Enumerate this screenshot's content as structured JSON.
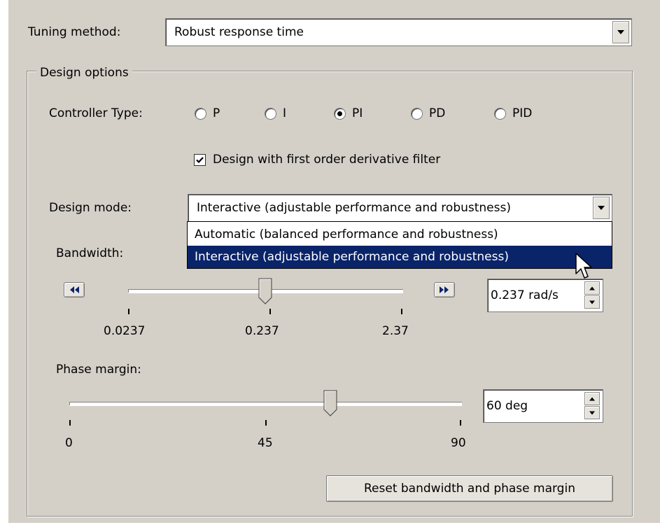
{
  "tuning": {
    "label": "Tuning method:",
    "value": "Robust response time"
  },
  "design_options": {
    "title": "Design options",
    "controller_type": {
      "label": "Controller Type:",
      "options": [
        "P",
        "I",
        "PI",
        "PD",
        "PID"
      ],
      "selected": "PI"
    },
    "derivative_filter": {
      "label": "Design with first order derivative filter",
      "checked": true
    },
    "design_mode": {
      "label": "Design mode:",
      "value": "Interactive (adjustable performance and robustness)",
      "options": [
        "Automatic (balanced performance and robustness)",
        "Interactive (adjustable performance and robustness)"
      ],
      "highlighted": "Interactive (adjustable performance and robustness)"
    },
    "bandwidth": {
      "label": "Bandwidth:",
      "value_text": "0.237 rad/s",
      "ticks": [
        "0.0237",
        "0.237",
        "2.37"
      ],
      "position_fraction": 0.5
    },
    "phase_margin": {
      "label": "Phase margin:",
      "value_text": "60 deg",
      "ticks": [
        "0",
        "45",
        "90"
      ],
      "position_fraction": 0.667
    },
    "reset_button": "Reset bandwidth and phase margin"
  },
  "icons": [
    "chevron-down-icon",
    "rewind-icon",
    "fast-forward-icon",
    "spin-up-icon",
    "spin-down-icon",
    "mouse-pointer-icon"
  ],
  "colors": {
    "panel": "#d4d0c8",
    "selection": "#0a246a",
    "selection_text": "#ffffff"
  }
}
